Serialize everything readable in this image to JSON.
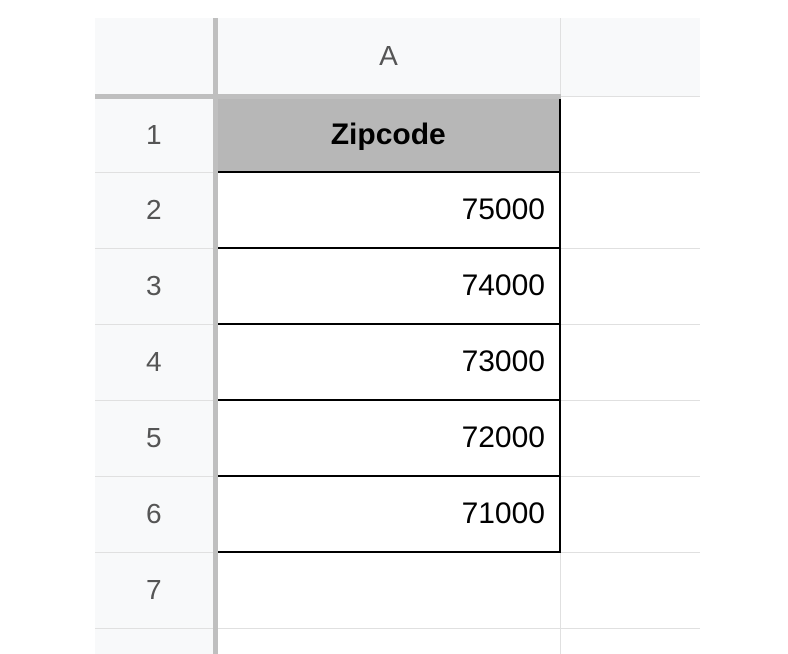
{
  "columns": {
    "A": "A"
  },
  "rows": {
    "r1": "1",
    "r2": "2",
    "r3": "3",
    "r4": "4",
    "r5": "5",
    "r6": "6",
    "r7": "7"
  },
  "cells": {
    "A1": "Zipcode",
    "A2": "75000",
    "A3": "74000",
    "A4": "73000",
    "A5": "72000",
    "A6": "71000",
    "A7": ""
  },
  "chart_data": {
    "type": "table",
    "columns": [
      "Zipcode"
    ],
    "rows": [
      [
        75000
      ],
      [
        74000
      ],
      [
        73000
      ],
      [
        72000
      ],
      [
        71000
      ]
    ]
  }
}
